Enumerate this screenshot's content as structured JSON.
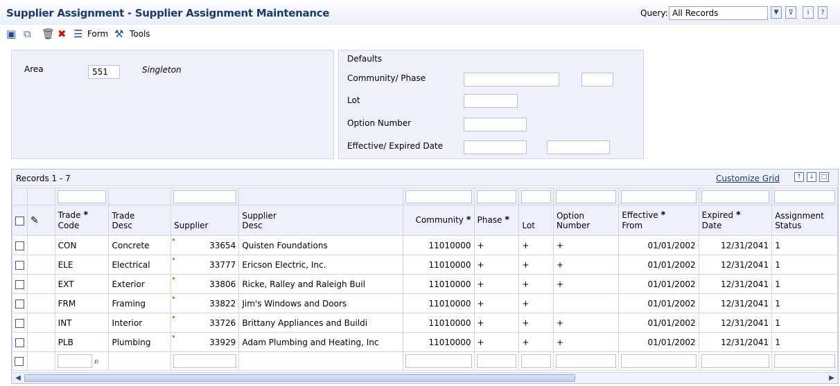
{
  "window": {
    "title": "Supplier Assignment - Supplier Assignment Maintenance"
  },
  "query": {
    "label": "Query:",
    "value": "All Records"
  },
  "toolbar": {
    "form_label": "Form",
    "tools_label": "Tools"
  },
  "header": {
    "area_label": "Area",
    "area_value": "551",
    "area_name": "Singleton"
  },
  "defaults": {
    "title": "Defaults",
    "community_phase_label": "Community/ Phase",
    "lot_label": "Lot",
    "option_number_label": "Option Number",
    "effective_expired_label": "Effective/ Expired Date"
  },
  "grid": {
    "records_label": "Records 1 - 7",
    "customize_label": "Customize Grid",
    "columns": {
      "trade_code": [
        "Trade",
        "Code"
      ],
      "trade_desc": [
        "Trade",
        "Desc"
      ],
      "supplier": "Supplier",
      "supplier_desc": [
        "Supplier",
        "Desc"
      ],
      "community": "Community",
      "phase": "Phase",
      "lot": "Lot",
      "option_number": [
        "Option",
        "Number"
      ],
      "effective_from": [
        "Effective",
        "From"
      ],
      "expired_date": [
        "Expired",
        "Date"
      ],
      "assignment_status": [
        "Assignment",
        "Status"
      ]
    },
    "rows": [
      {
        "trade_code": "CON",
        "trade_desc": "Concrete",
        "supplier": "33654",
        "supplier_desc": "Quisten Foundations",
        "community": "11010000",
        "phase": "+",
        "lot": "+",
        "option_number": "+",
        "effective_from": "01/01/2002",
        "expired_date": "12/31/2041",
        "assignment_status": "1"
      },
      {
        "trade_code": "ELE",
        "trade_desc": "Electrical",
        "supplier": "33777",
        "supplier_desc": "Ericson Electric, Inc.",
        "community": "11010000",
        "phase": "+",
        "lot": "+",
        "option_number": "+",
        "effective_from": "01/01/2002",
        "expired_date": "12/31/2041",
        "assignment_status": "1"
      },
      {
        "trade_code": "EXT",
        "trade_desc": "Exterior",
        "supplier": "33806",
        "supplier_desc": "Ricke, Ralley and Raleigh Buil",
        "community": "11010000",
        "phase": "+",
        "lot": "+",
        "option_number": "+",
        "effective_from": "01/01/2002",
        "expired_date": "12/31/2041",
        "assignment_status": "1"
      },
      {
        "trade_code": "FRM",
        "trade_desc": "Framing",
        "supplier": "33822",
        "supplier_desc": "Jim's Windows and Doors",
        "community": "11010000",
        "phase": "+",
        "lot": "+",
        "option_number": "",
        "effective_from": "01/01/2002",
        "expired_date": "12/31/2041",
        "assignment_status": "1"
      },
      {
        "trade_code": "INT",
        "trade_desc": "Interior",
        "supplier": "33726",
        "supplier_desc": "Brittany Appliances and Buildi",
        "community": "11010000",
        "phase": "+",
        "lot": "+",
        "option_number": "+",
        "effective_from": "01/01/2002",
        "expired_date": "12/31/2041",
        "assignment_status": "1"
      },
      {
        "trade_code": "PLB",
        "trade_desc": "Plumbing",
        "supplier": "33929",
        "supplier_desc": "Adam Plumbing and Heating, Inc",
        "community": "11010000",
        "phase": "+",
        "lot": "+",
        "option_number": "+",
        "effective_from": "01/01/2002",
        "expired_date": "12/31/2041",
        "assignment_status": "1"
      }
    ]
  },
  "icons": {
    "save": "save-icon",
    "copy": "copy-icon",
    "delete": "trash-icon",
    "cancel": "close-icon",
    "form": "form-icon",
    "tools": "tools-icon",
    "search": "search-icon"
  },
  "colors": {
    "title": "#1c3a6b",
    "panel": "#eef0fb",
    "required_marker": "#f07a10"
  }
}
